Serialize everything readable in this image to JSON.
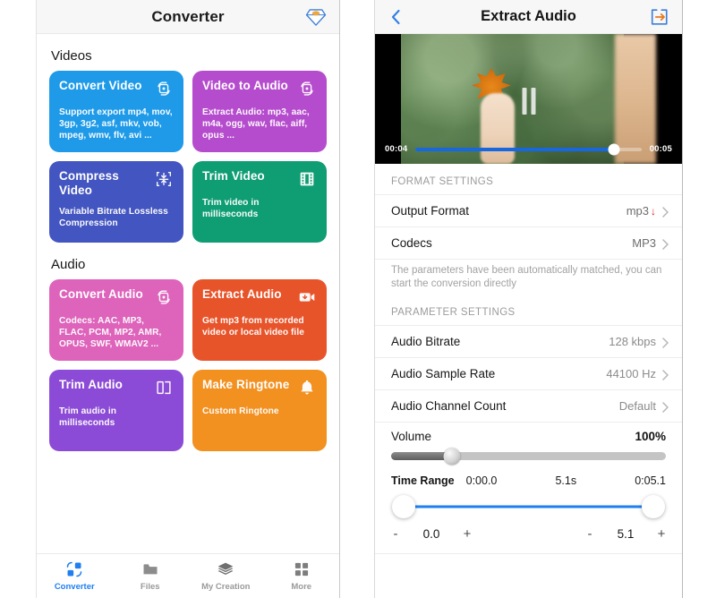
{
  "left_phone": {
    "header": {
      "title": "Converter",
      "pro_icon": "gem-pro-icon"
    },
    "sections": [
      {
        "title": "Videos",
        "cards": [
          {
            "title": "Convert Video",
            "desc": "Support export mp4, mov, 3gp, 3g2, asf, mkv, vob, mpeg, wmv, flv, avi ...",
            "color": "#1e9ae8",
            "icon": "convert-video-icon"
          },
          {
            "title": "Video to Audio",
            "desc": "Extract Audio: mp3, aac, m4a, ogg, wav, flac, aiff, opus ...",
            "color": "#b54ccd",
            "icon": "convert-video-icon"
          },
          {
            "title": "Compress Video",
            "desc": "Variable Bitrate Lossless Compression",
            "color": "#4355c0",
            "icon": "compress-icon"
          },
          {
            "title": "Trim Video",
            "desc": "Trim video in milliseconds",
            "color": "#0f9d73",
            "icon": "film-strip-icon"
          }
        ]
      },
      {
        "title": "Audio",
        "cards": [
          {
            "title": "Convert Audio",
            "desc": "Codecs: AAC, MP3, FLAC, PCM, MP2, AMR, OPUS, SWF, WMAV2 ...",
            "color": "#dd63bb",
            "icon": "convert-video-icon"
          },
          {
            "title": "Extract Audio",
            "desc": "Get mp3 from recorded video or local video file",
            "color": "#e8542a",
            "icon": "video-download-icon"
          },
          {
            "title": "Trim Audio",
            "desc": "Trim audio in milliseconds",
            "color": "#8c4bd6",
            "icon": "trim-brackets-icon"
          },
          {
            "title": "Make Ringtone",
            "desc": "Custom Ringtone",
            "color": "#f29020",
            "icon": "bell-icon"
          }
        ]
      }
    ],
    "nav": [
      {
        "label": "Converter",
        "icon": "converter-icon",
        "active": true
      },
      {
        "label": "Files",
        "icon": "folder-icon",
        "active": false
      },
      {
        "label": "My Creation",
        "icon": "layers-icon",
        "active": false
      },
      {
        "label": "More",
        "icon": "grid-icon",
        "active": false
      }
    ],
    "accent_color": "#1f7ff0"
  },
  "right_phone": {
    "header": {
      "title": "Extract Audio",
      "back_icon": "back-chevron-icon",
      "export_icon": "export-arrow-icon"
    },
    "player": {
      "current_time": "00:04",
      "total_time": "00:05",
      "progress_percent": 88,
      "state_icon": "pause-icon"
    },
    "format_settings": {
      "group_label": "FORMAT SETTINGS",
      "rows": [
        {
          "label": "Output Format",
          "value": "mp3",
          "badge": "↓",
          "chevron": true
        },
        {
          "label": "Codecs",
          "value": "MP3",
          "chevron": true
        }
      ],
      "hint": "The parameters have been automatically matched, you can start the conversion directly"
    },
    "parameter_settings": {
      "group_label": "PARAMETER SETTINGS",
      "rows": [
        {
          "label": "Audio Bitrate",
          "value": "128 kbps",
          "chevron": true
        },
        {
          "label": "Audio Sample Rate",
          "value": "44100 Hz",
          "chevron": true
        },
        {
          "label": "Audio Channel Count",
          "value": "Default",
          "chevron": true
        }
      ],
      "volume": {
        "label": "Volume",
        "value": "100%",
        "slider_percent": 22
      },
      "time_range": {
        "label": "Time Range",
        "start": "0:00.0",
        "duration": "5.1s",
        "end": "0:05.1",
        "start_stepper": {
          "minus": "-",
          "value": "0.0",
          "plus": "+"
        },
        "end_stepper": {
          "minus": "-",
          "value": "5.1",
          "plus": "+"
        }
      }
    },
    "accent_color": "#1f7ff0"
  }
}
